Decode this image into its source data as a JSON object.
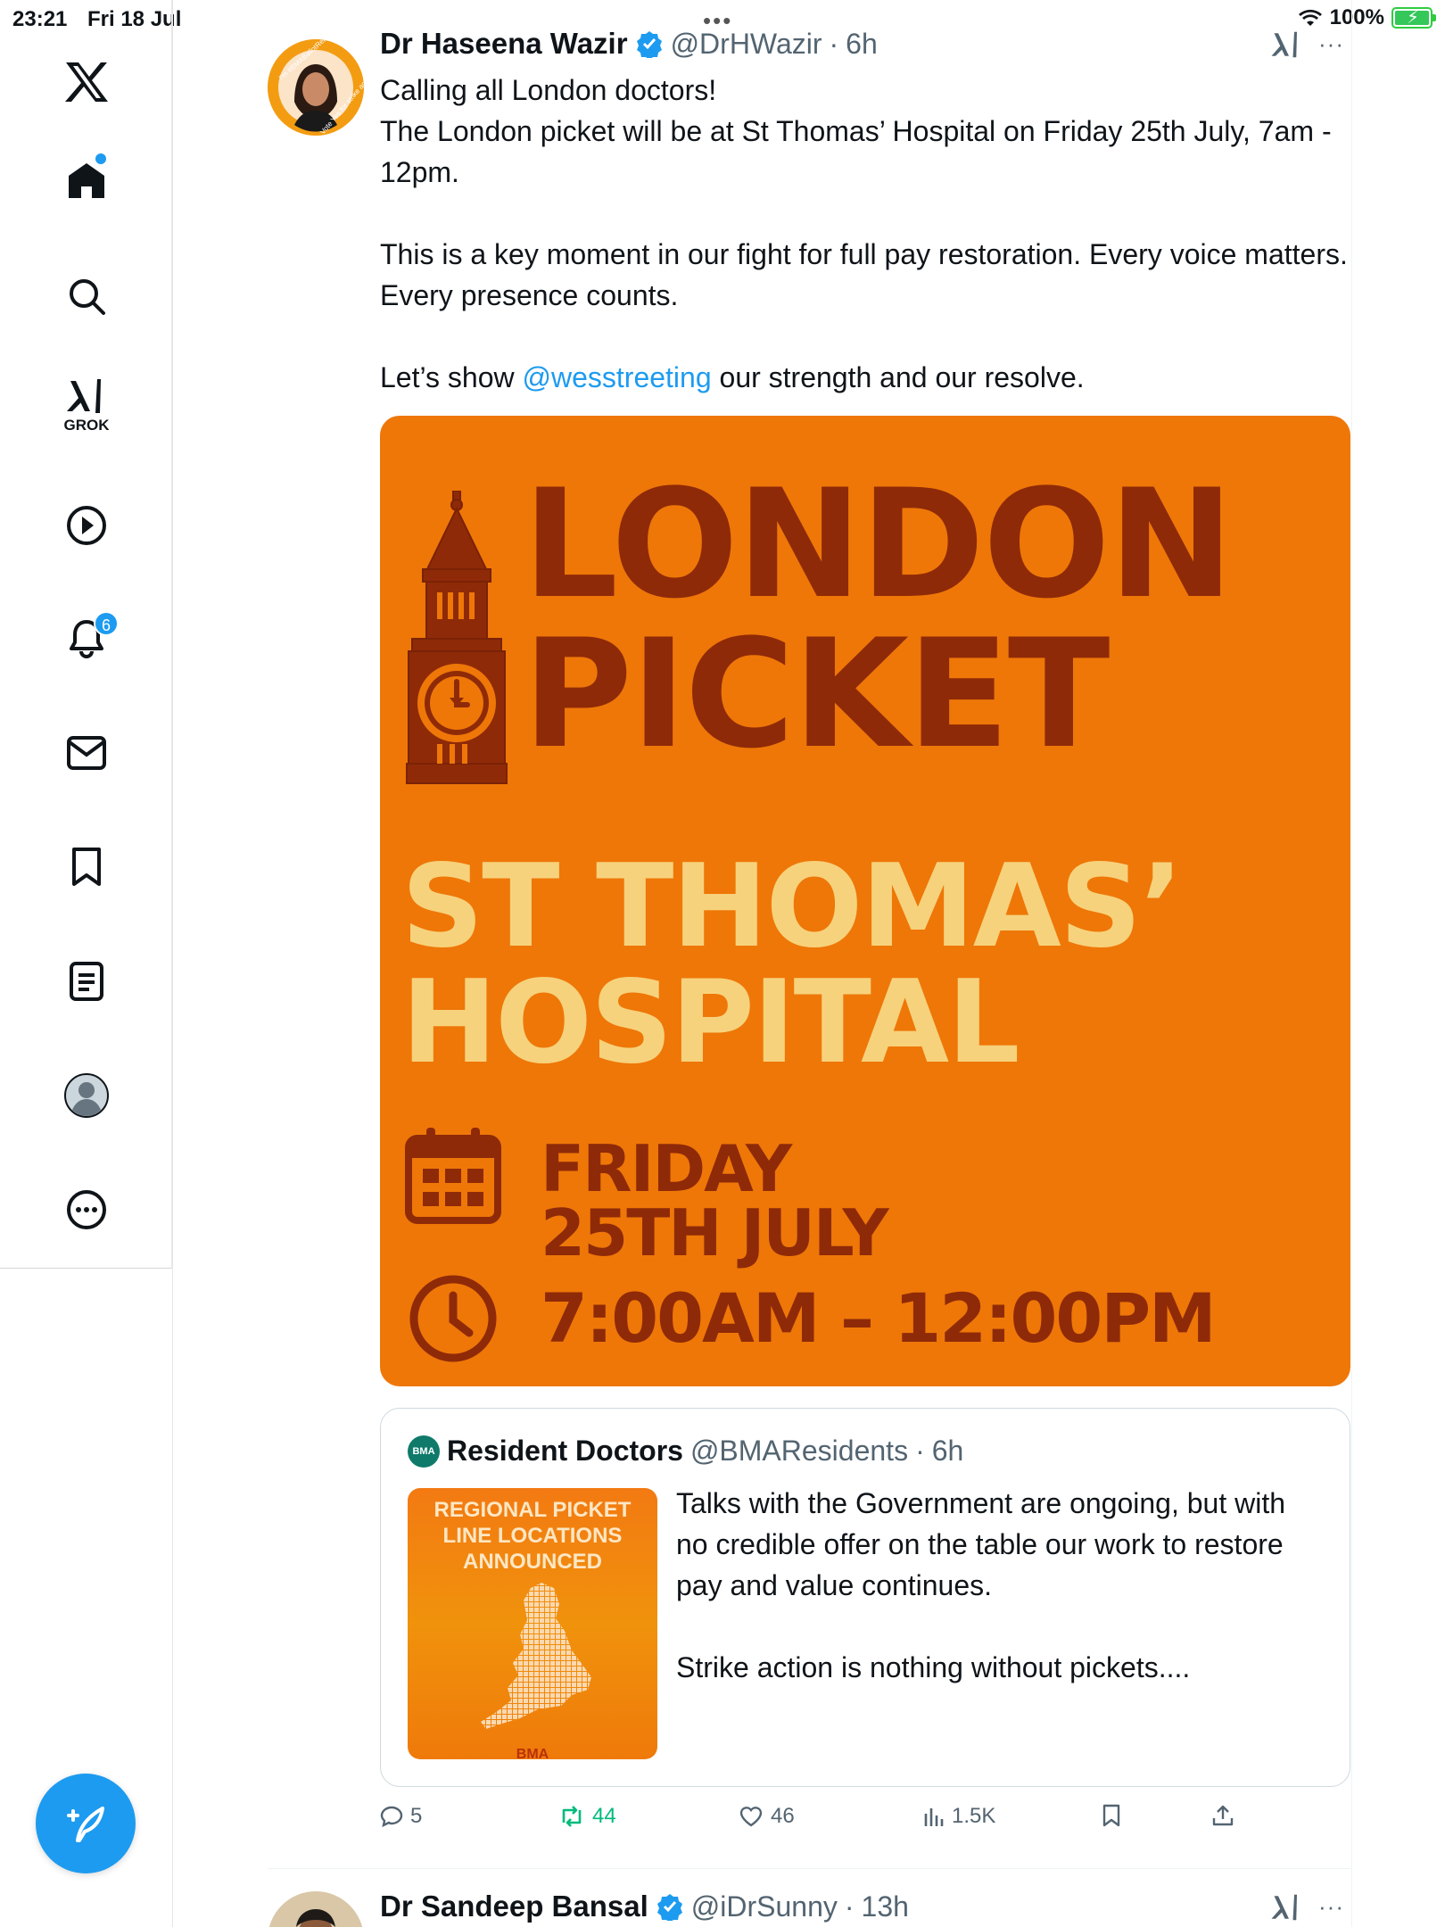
{
  "status_bar": {
    "time": "23:21",
    "date": "Fri 18 Jul",
    "battery": "100%",
    "battery_level": 1.0
  },
  "sidebar": {
    "items": [
      {
        "name": "x-logo"
      },
      {
        "name": "home"
      },
      {
        "name": "search"
      },
      {
        "name": "grok",
        "label": "GROK"
      },
      {
        "name": "video"
      },
      {
        "name": "notifications",
        "badge": "6"
      },
      {
        "name": "messages"
      },
      {
        "name": "bookmarks"
      },
      {
        "name": "lists"
      },
      {
        "name": "profile"
      },
      {
        "name": "more"
      }
    ],
    "compose_icon": "compose-icon"
  },
  "tweet": {
    "author_name": "Dr Haseena Wazir",
    "handle": "@DrHWazir",
    "sep": "·",
    "time": "6h",
    "avatar_ring_text": "I'm #BMABallotReady",
    "avatar_ring_text2": "Vote Yes for strike action",
    "text_line1": "Calling all London doctors!",
    "text_line2": "The London picket will be at St Thomas’ Hospital on Friday 25th July, 7am - 12pm.",
    "text_para2": "This is a key moment in our fight for full pay restoration. Every voice matters. Every presence counts.",
    "text_para3_prefix": "Let’s show ",
    "text_para3_mention": "@wesstreeting",
    "text_para3_suffix": " our strength and our resolve.",
    "poster": {
      "line1": "LONDON",
      "line2": "PICKET",
      "line3": "ST THOMAS’",
      "line4": "HOSPITAL",
      "date1": "FRIDAY",
      "date2": "25TH JULY",
      "time": "7:00AM – 12:00PM"
    },
    "quote": {
      "badge": "BMA",
      "author_name": "Resident Doctors",
      "handle": "@BMAResidents",
      "sep": "·",
      "time": "6h",
      "thumb_title": "REGIONAL PICKET LINE LOCATIONS ANNOUNCED",
      "thumb_footer": "BMA",
      "text_para1": "Talks with the Government are ongoing, but with no credible offer on the table our work to restore pay and value continues.",
      "text_para2": "Strike action is nothing without pickets...."
    },
    "actions": {
      "replies": "5",
      "reposts": "44",
      "likes": "46",
      "views": "1.5K"
    },
    "repost_color": "#00ba7c"
  },
  "next_tweet": {
    "author_name": "Dr Sandeep Bansal",
    "handle": "@iDrSunny",
    "sep": "·",
    "time": "13h"
  },
  "colors": {
    "accent": "#1d9bf0",
    "poster_orange": "#ee7708",
    "poster_dark": "#8f2a08",
    "poster_yellow": "#f7d27c"
  }
}
